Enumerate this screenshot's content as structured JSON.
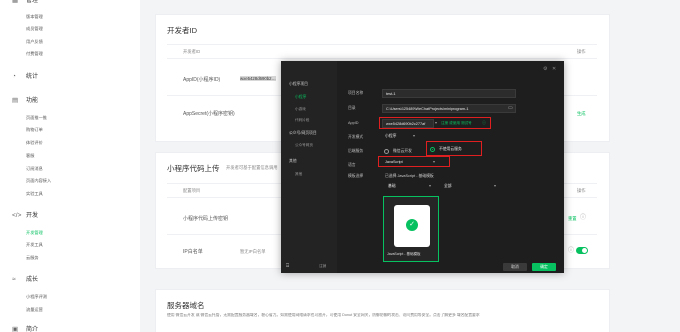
{
  "sidebar": {
    "top_group": "管理",
    "top_items": [
      "版本管理",
      "成员管理",
      "用户反馈",
      "付费管理"
    ],
    "stats": "统计",
    "features": "功能",
    "feature_items": [
      "页面推一推",
      "购物订单",
      "体验评价",
      "客服",
      "订阅消息",
      "页面内容接入",
      "实验工具"
    ],
    "dev": "开发",
    "dev_items": [
      "开发管理",
      "开发工具",
      "云服务"
    ],
    "growth": "成长",
    "growth_items": [
      "小程序评测",
      "流量运营"
    ],
    "last_group": "简介"
  },
  "dev_id_card": {
    "title": "开发者ID",
    "col_id": "开发者ID",
    "col_action": "操作",
    "appid_label": "AppID(小程序ID)",
    "appid_value": "wxe5428d690b2…",
    "secret_label": "AppSecret(小程序密钥)",
    "secret_action": "生成"
  },
  "upload_card": {
    "title": "小程序代码上传",
    "subtitle": "开发者可基于配置信息调用",
    "col_config": "配置项目",
    "col_action": "操作",
    "key_label": "小程序代码上传密钥",
    "key_action": "重置",
    "ip_label": "IP白名单",
    "ip_value": "暂无IP白名单"
  },
  "domain_card": {
    "title": "服务器域名",
    "desc": "使用 微信云开发 或 微信云托管，无需配置服务器域名，稳心省力。如需使用网络请求也可放开，可使用 Donut 安全网关，防御防御的攻击、访问费用等安全。点击了解更多 域名配置要求"
  },
  "modal": {
    "nav": {
      "section1": "小程序项目",
      "section1_items": [
        "小程序",
        "小游戏",
        "代码片段"
      ],
      "section2": "公众号/网页项目",
      "section2_items": [
        "公众号网页"
      ],
      "section3": "其他",
      "section3_items": [
        "其他"
      ]
    },
    "fields": {
      "name_label": "项目名称",
      "name_value": "test-1",
      "dir_label": "目录",
      "dir_value": "C:\\Users\\125489\\WeChatProjects\\miniprogram-1",
      "appid_label": "AppID",
      "appid_value": "wxe5428d690b2c277af",
      "appid_link": "注册 或使用 测试号",
      "mode_label": "开发模式",
      "mode_value": "小程序",
      "backend_label": "后端服务",
      "backend_opt1": "微信云开发",
      "backend_opt2": "不使用云服务",
      "lang_label": "语言",
      "lang_value": "JavaScript",
      "tpl_label": "模板选择",
      "tpl_value": "已选择 JavaScript - 基础模板",
      "filter1": "基础",
      "filter2": "全部",
      "tpl_card_label": "JavaScript - 基础模板"
    },
    "footer": {
      "tips": "注销",
      "cancel": "取消",
      "confirm": "确定"
    }
  }
}
